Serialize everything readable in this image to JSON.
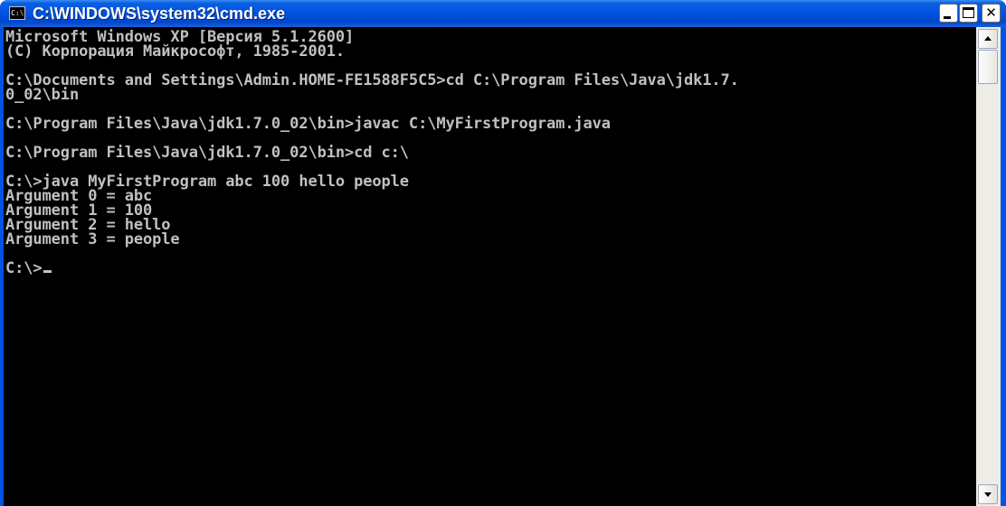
{
  "window": {
    "title": "C:\\WINDOWS\\system32\\cmd.exe",
    "icon_label": "C:\\",
    "icon": "cmd-window-icon",
    "buttons": {
      "minimize_icon": "minimize-icon",
      "maximize_icon": "maximize-icon",
      "close_icon": "close-icon",
      "close_glyph": "✕"
    },
    "colors": {
      "titlebar": "#0054e3",
      "console_bg": "#000000",
      "console_text": "#c0c0c0"
    }
  },
  "console": {
    "lines": [
      "Microsoft Windows XP [Версия 5.1.2600]",
      "(С) Корпорация Майкрософт, 1985-2001.",
      "",
      "C:\\Documents and Settings\\Admin.HOME-FE1588F5C5>cd C:\\Program Files\\Java\\jdk1.7.",
      "0_02\\bin",
      "",
      "C:\\Program Files\\Java\\jdk1.7.0_02\\bin>javac C:\\MyFirstProgram.java",
      "",
      "C:\\Program Files\\Java\\jdk1.7.0_02\\bin>cd c:\\",
      "",
      "C:\\>java MyFirstProgram abc 100 hello people",
      "Argument 0 = abc",
      "Argument 1 = 100",
      "Argument 2 = hello",
      "Argument 3 = people",
      "",
      "C:\\>"
    ]
  },
  "scrollbar": {
    "up_icon": "arrow-up-icon",
    "down_icon": "arrow-down-icon"
  }
}
